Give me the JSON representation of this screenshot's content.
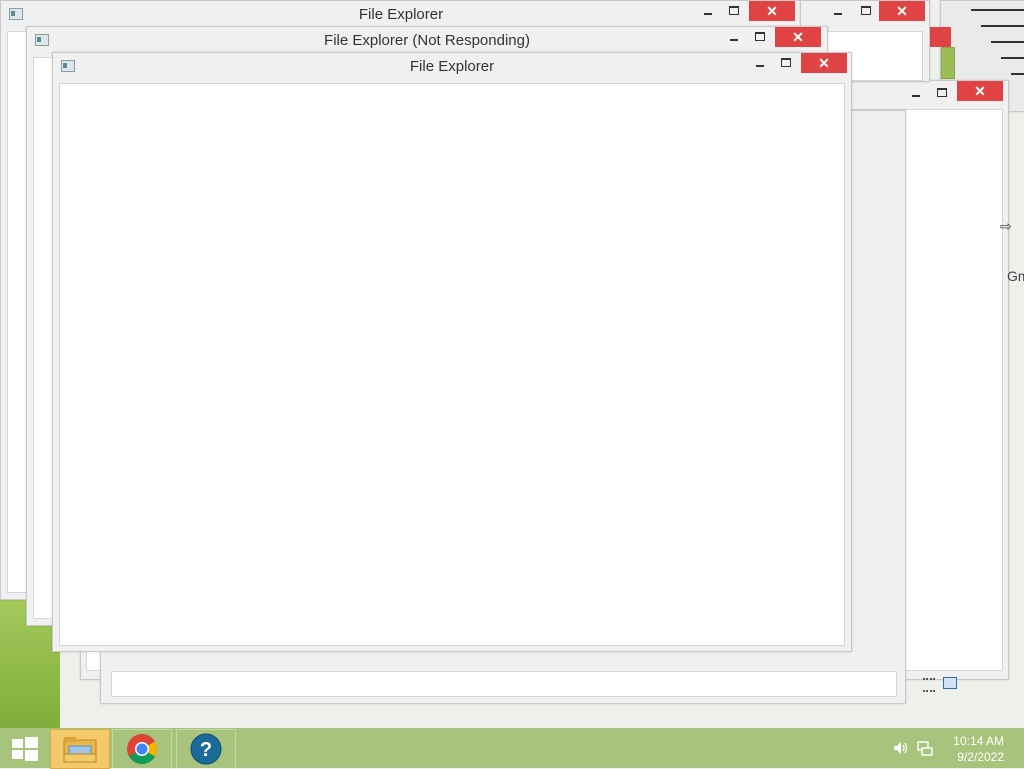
{
  "windows": {
    "back": {
      "title": "File Explorer"
    },
    "middle": {
      "title": "File Explorer (Not Responding)"
    },
    "front": {
      "title": "File Explorer"
    },
    "close_glyph": "✕"
  },
  "background_fragments": {
    "text_fragment": "Gm"
  },
  "taskbar": {
    "start_icon": "windows-logo-icon",
    "apps": [
      {
        "name": "File Explorer",
        "icon": "folder-icon",
        "active": true
      },
      {
        "name": "Google Chrome",
        "icon": "chrome-icon",
        "active": false
      },
      {
        "name": "Help",
        "icon": "help-icon",
        "active": false
      }
    ],
    "tray": {
      "volume_icon": "speaker-icon",
      "network_icon": "network-icon",
      "time": "10:14 AM",
      "date": "9/2/2022"
    }
  },
  "colors": {
    "close_button": "#e04343",
    "taskbar": "#a8c47c",
    "active_task": "#f4c96a",
    "desktop_accent": "#8cb94a"
  }
}
